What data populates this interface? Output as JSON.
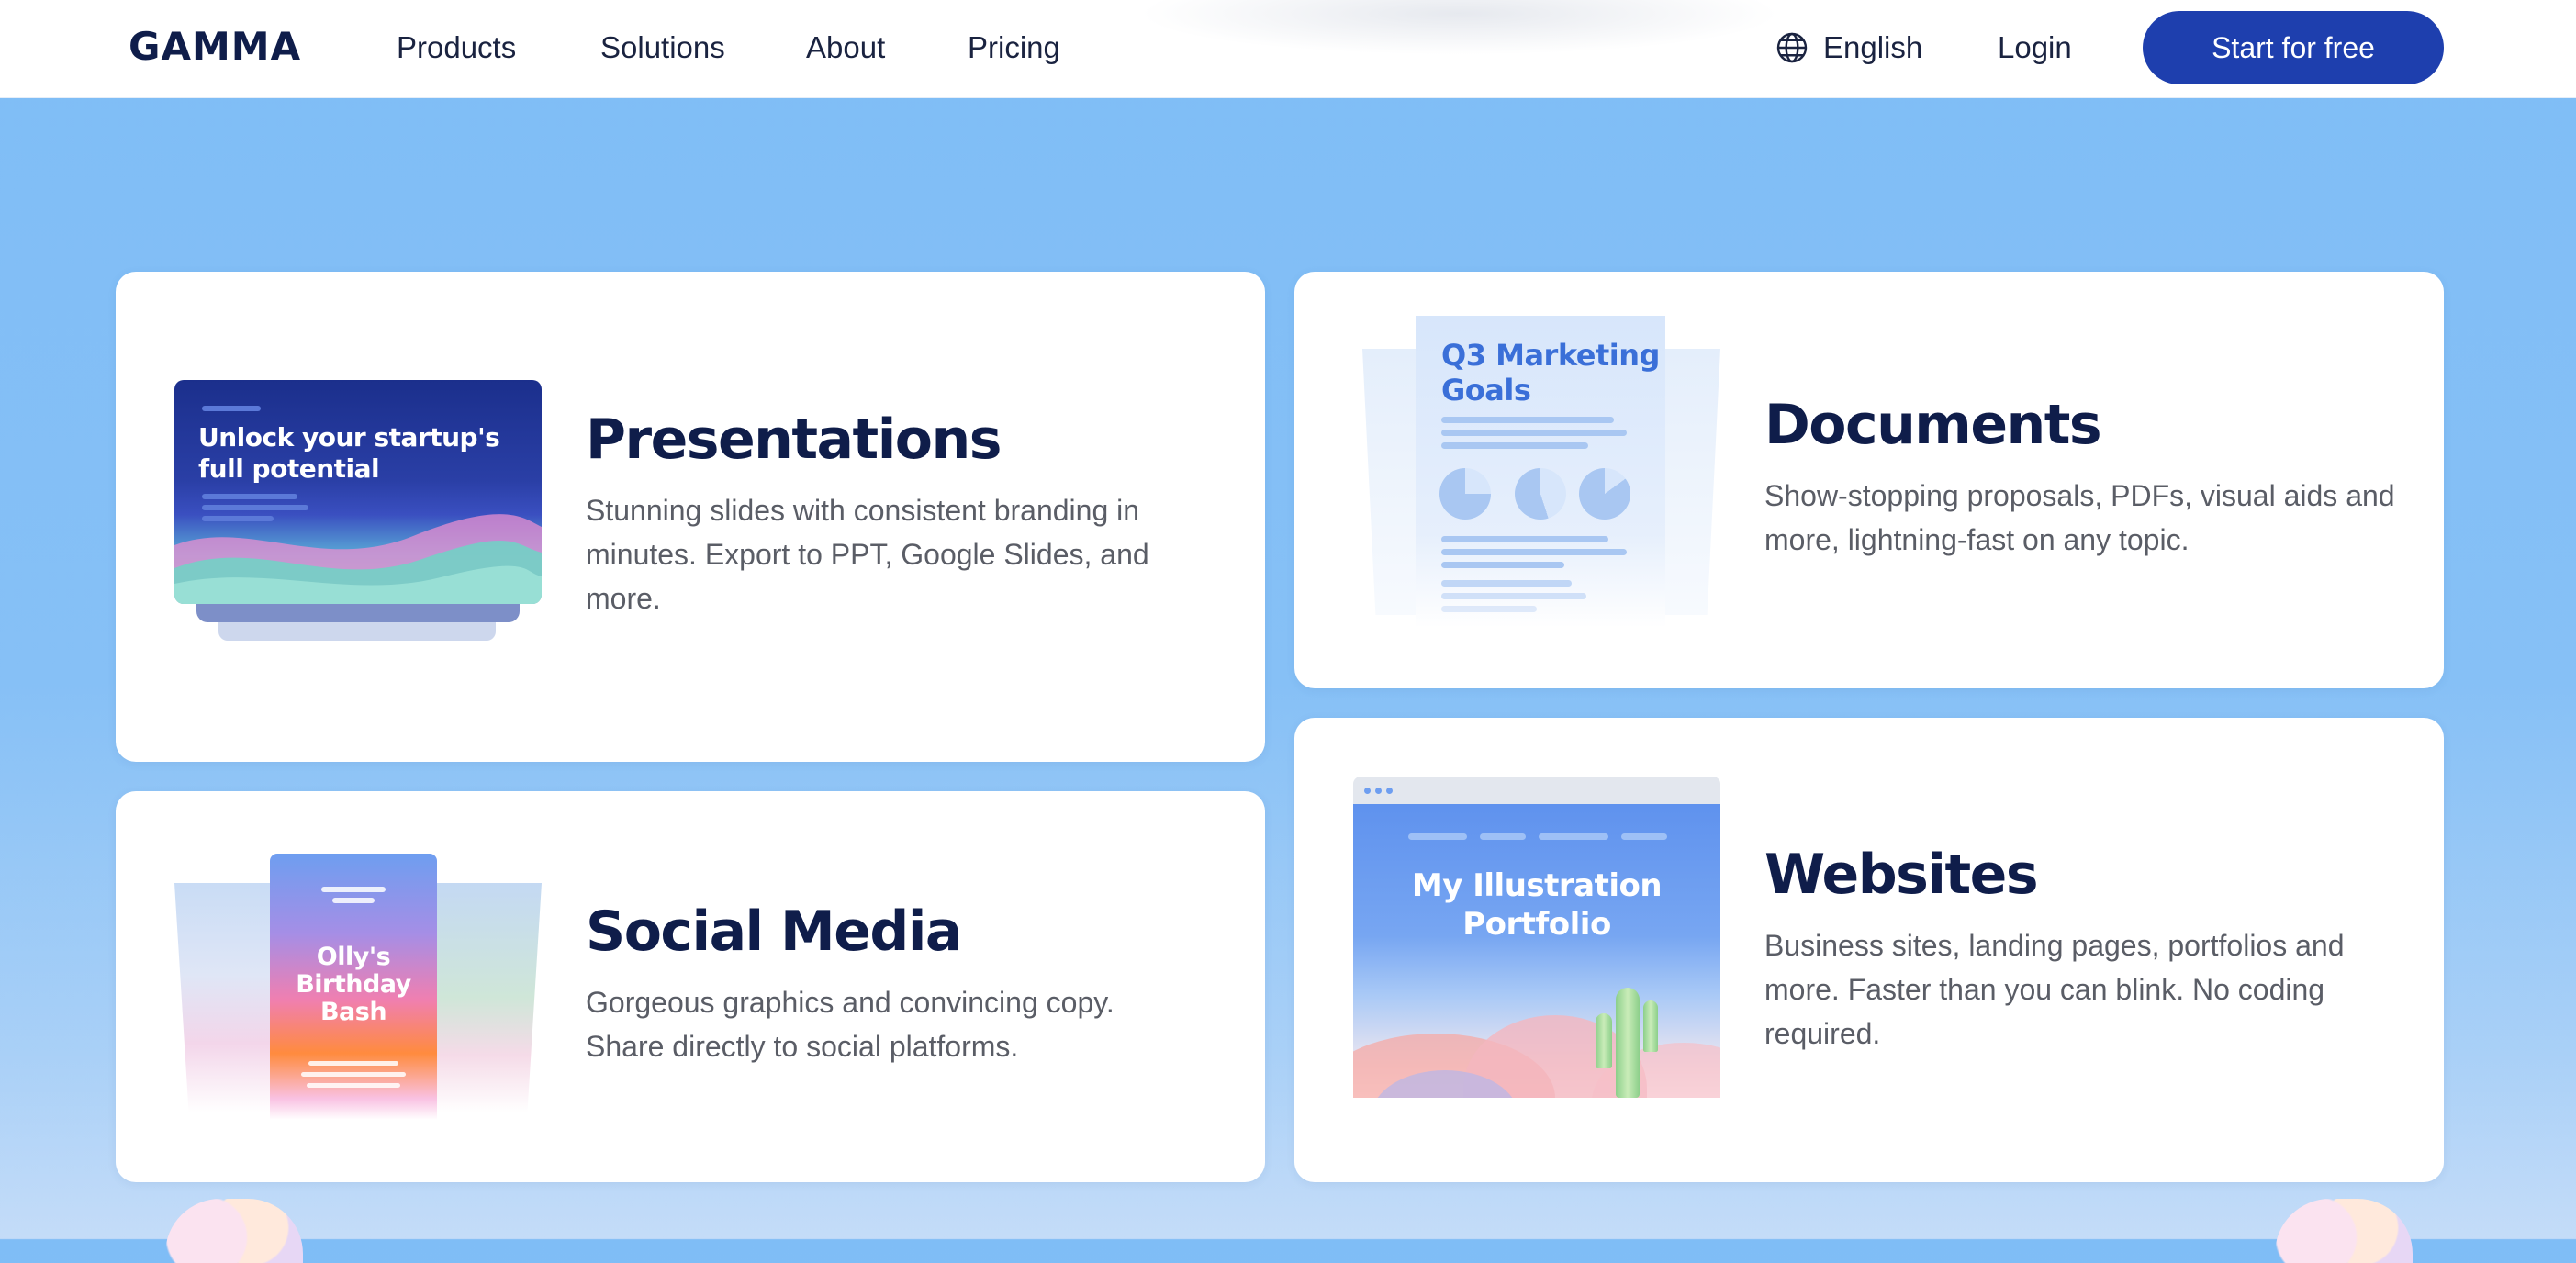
{
  "nav": {
    "logo": "GAMMA",
    "links": [
      "Products",
      "Solutions",
      "About",
      "Pricing"
    ],
    "language": "English",
    "login": "Login",
    "cta": "Start for free"
  },
  "cards": {
    "presentations": {
      "title": "Presentations",
      "description": "Stunning slides with consistent branding in minutes. Export to PPT, Google Slides, and more.",
      "thumb_text": "Unlock your startup's full potential"
    },
    "documents": {
      "title": "Documents",
      "description": "Show-stopping proposals, PDFs, visual aids and more, lightning-fast on any topic.",
      "thumb_text": "Q3 Marketing Goals"
    },
    "social": {
      "title": "Social Media",
      "description": "Gorgeous graphics and convincing copy. Share directly to social platforms.",
      "thumb_text": "Olly's Birthday Bash"
    },
    "websites": {
      "title": "Websites",
      "description": "Business sites, landing pages, portfolios and more. Faster than you can blink. No coding required.",
      "thumb_text": "My Illustration Portfolio"
    }
  },
  "colors": {
    "brand_dark": "#0f1d4a",
    "cta_bg": "#1e3fae",
    "page_bg": "#86c0f6",
    "text_muted": "#5a5d66"
  },
  "icons": {
    "language": "globe-icon"
  }
}
